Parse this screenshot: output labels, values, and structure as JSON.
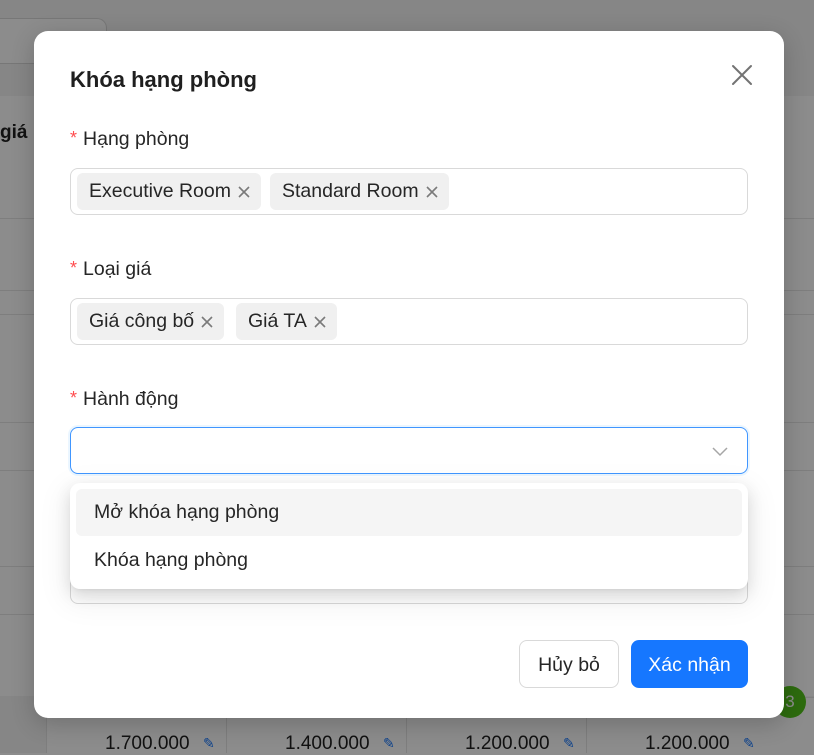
{
  "background": {
    "title_fragment": "giá p",
    "prices": [
      "1.700.000",
      "1.400.000",
      "1.200.000",
      "1.200.000"
    ],
    "badge_count": "3"
  },
  "modal": {
    "title": "Khóa hạng phòng",
    "required_mark": "*",
    "room_class": {
      "label": "Hạng phòng",
      "tags": [
        "Executive Room",
        "Standard Room"
      ]
    },
    "rate_type": {
      "label": "Loại giá",
      "tags": [
        "Giá công bố",
        "Giá TA"
      ]
    },
    "action": {
      "label": "Hành động",
      "value": "",
      "options": [
        "Mở khóa hạng phòng",
        "Khóa hạng phòng"
      ]
    },
    "cancel_label": "Hủy bỏ",
    "confirm_label": "Xác nhận"
  },
  "colors": {
    "primary": "#1677ff",
    "required": "#ff4d4f",
    "badge": "#52c41a"
  },
  "icons": {
    "close": "close-icon",
    "tag_remove": "close-small-icon",
    "dropdown": "chevron-down-icon",
    "edit": "pencil-icon"
  }
}
